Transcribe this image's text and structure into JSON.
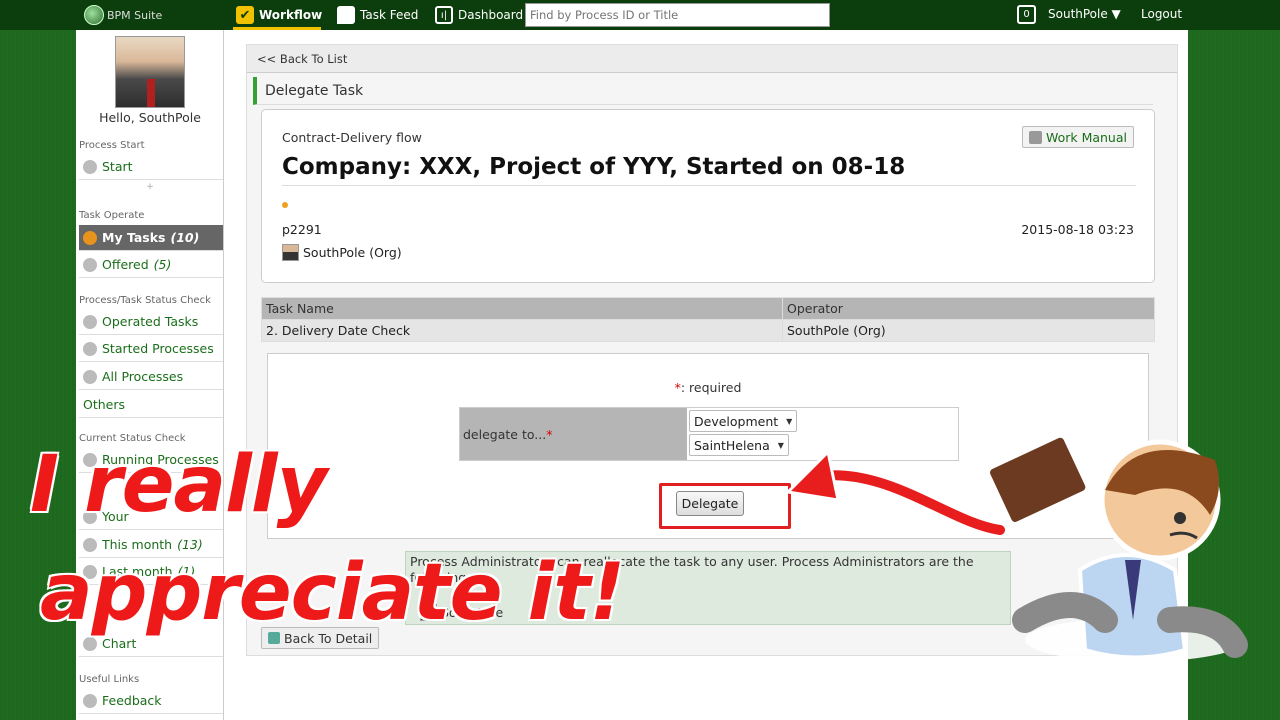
{
  "topbar": {
    "logo": "BPM Suite",
    "nav": [
      {
        "label": "Workflow"
      },
      {
        "label": "Task Feed"
      },
      {
        "label": "Dashboard"
      }
    ],
    "search_placeholder": "Find by Process ID or Title",
    "notification_count": "0",
    "user": "SouthPole ▼",
    "logout": "Logout"
  },
  "sidebar": {
    "greeting": "Hello, SouthPole",
    "sections": {
      "process_start": "Process Start",
      "task_operate": "Task Operate",
      "status_check": "Process/Task Status Check",
      "current_status": "Current Status Check",
      "useful_links": "Useful Links"
    },
    "items": {
      "start": "Start",
      "my_tasks": "My Tasks",
      "my_tasks_count": "(10)",
      "offered": "Offered",
      "offered_count": "(5)",
      "operated_tasks": "Operated Tasks",
      "started_processes": "Started Processes",
      "all_processes": "All Processes",
      "others": "Others",
      "running_processes": "Running Processes",
      "your": "Your",
      "this_month": "This month",
      "this_month_count": "(13)",
      "last_month": "Last month",
      "last_month_count": "(1)",
      "chart": "Chart",
      "feedback": "Feedback"
    }
  },
  "main": {
    "back_to_list": "<< Back To List",
    "page_title": "Delegate Task",
    "card": {
      "flow_name": "Contract-Delivery flow",
      "work_manual": "Work Manual",
      "title": "Company: XXX, Project of YYY, Started on 08-18",
      "process_id": "p2291",
      "date": "2015-08-18 03:23",
      "owner": "SouthPole (Org)"
    },
    "table": {
      "headers": [
        "Task Name",
        "Operator"
      ],
      "rows": [
        [
          "2. Delivery Date Check",
          "SouthPole (Org)"
        ]
      ]
    },
    "form": {
      "required_star": "*",
      "required_note": ": required",
      "delegate_label": "delegate to...",
      "org_select": "Development",
      "user_select": "SaintHelena",
      "delegate_button": "Delegate"
    },
    "admin_note": "Process Administrators can reallocate the task to any user. Process Administrators are the following:",
    "admin_user": "SouthPole",
    "back_to_detail": "Back To Detail"
  },
  "overlay": {
    "line1": "I really",
    "line2": "appreciate it!"
  },
  "colors": {
    "background": "#1f6b1f",
    "topbar": "#0c3d0c",
    "accent": "#f2c200",
    "link": "#1a6e1a",
    "highlight": "#e02020"
  }
}
